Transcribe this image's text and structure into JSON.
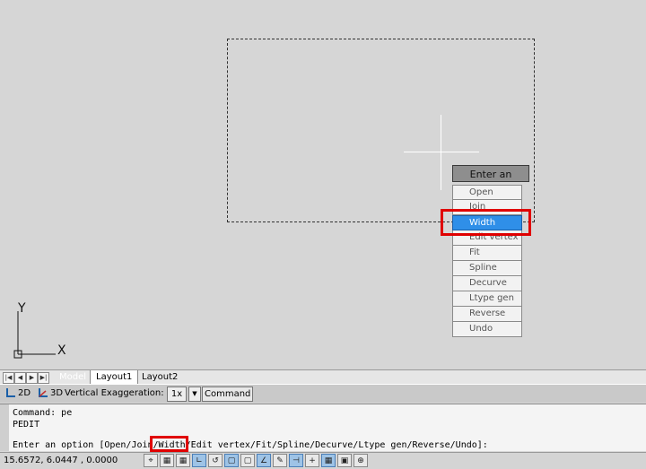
{
  "drawing": {
    "option_prompt": "Enter an option",
    "menu": [
      "Open",
      "Join",
      "Width",
      "Edit vertex",
      "Fit",
      "Spline",
      "Decurve",
      "Ltype gen",
      "Reverse",
      "Undo"
    ],
    "selected": "Width"
  },
  "ucs": {
    "y": "Y",
    "x": "X"
  },
  "tabs": {
    "model": "Model",
    "layout1": "Layout1",
    "layout2": "Layout2"
  },
  "toolbar": {
    "btn_2d": "2D",
    "btn_3d": "3D",
    "vert_exag_label": "Vertical Exaggeration:",
    "vert_exag_value": "1x",
    "command_label": "Command"
  },
  "command": {
    "line1": "Command: pe",
    "line2": "PEDIT",
    "line3": "Enter an option [Open/Join/Width/Edit vertex/Fit/Spline/Decurve/Ltype gen/Reverse/Undo]:"
  },
  "status": {
    "coords": "15.6572, 6.0447 , 0.0000",
    "icons": [
      "snap-icon",
      "grid-icon",
      "ortho-icon",
      "polar-icon",
      "osnap-icon",
      "otrack-icon",
      "ducs-icon",
      "dyn-icon",
      "lwt-icon",
      "qp-icon",
      "sc-icon",
      "am-icon",
      "tpy-icon",
      "model-icon"
    ]
  },
  "colors": {
    "highlight": "#e00000",
    "selected": "#2f8fe8",
    "canvas": "#d6d6d6"
  }
}
